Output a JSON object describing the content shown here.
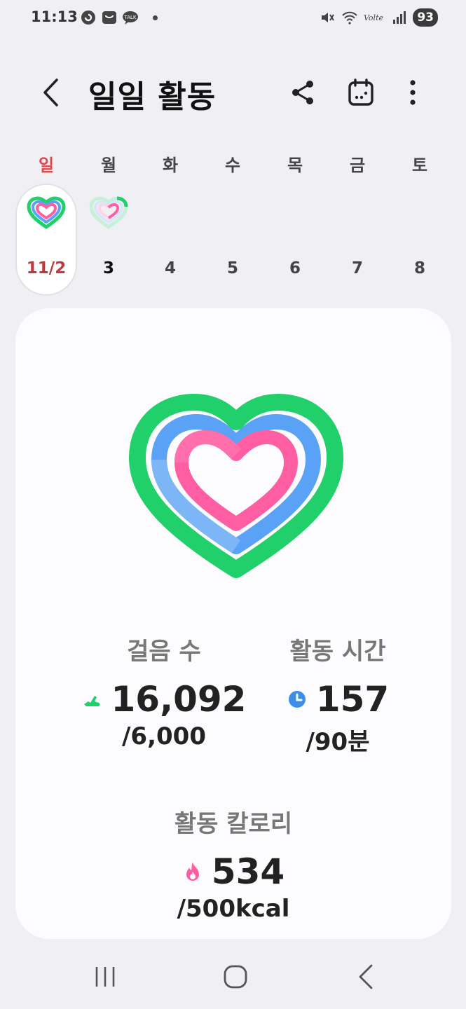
{
  "status_bar": {
    "time": "11:13",
    "battery": "93"
  },
  "header": {
    "title": "일일 활동"
  },
  "week": {
    "days": [
      "일",
      "월",
      "화",
      "수",
      "목",
      "금",
      "토"
    ],
    "dates": [
      "11/2",
      "3",
      "4",
      "5",
      "6",
      "7",
      "8"
    ],
    "selected_index": 0
  },
  "stats": {
    "steps": {
      "label": "걸음 수",
      "value": "16,092",
      "goal": "/6,000",
      "icon": "shoe-icon"
    },
    "active_time": {
      "label": "활동 시간",
      "value": "157",
      "goal": "/90분",
      "icon": "clock-icon"
    },
    "calories": {
      "label": "활동 칼로리",
      "value": "534",
      "goal": "/500kcal",
      "icon": "flame-icon"
    }
  },
  "colors": {
    "steps_ring": "#21d06a",
    "time_ring": "#5aa2f5",
    "calorie_ring": "#ff5ea2",
    "accent_red": "#e0464b"
  }
}
